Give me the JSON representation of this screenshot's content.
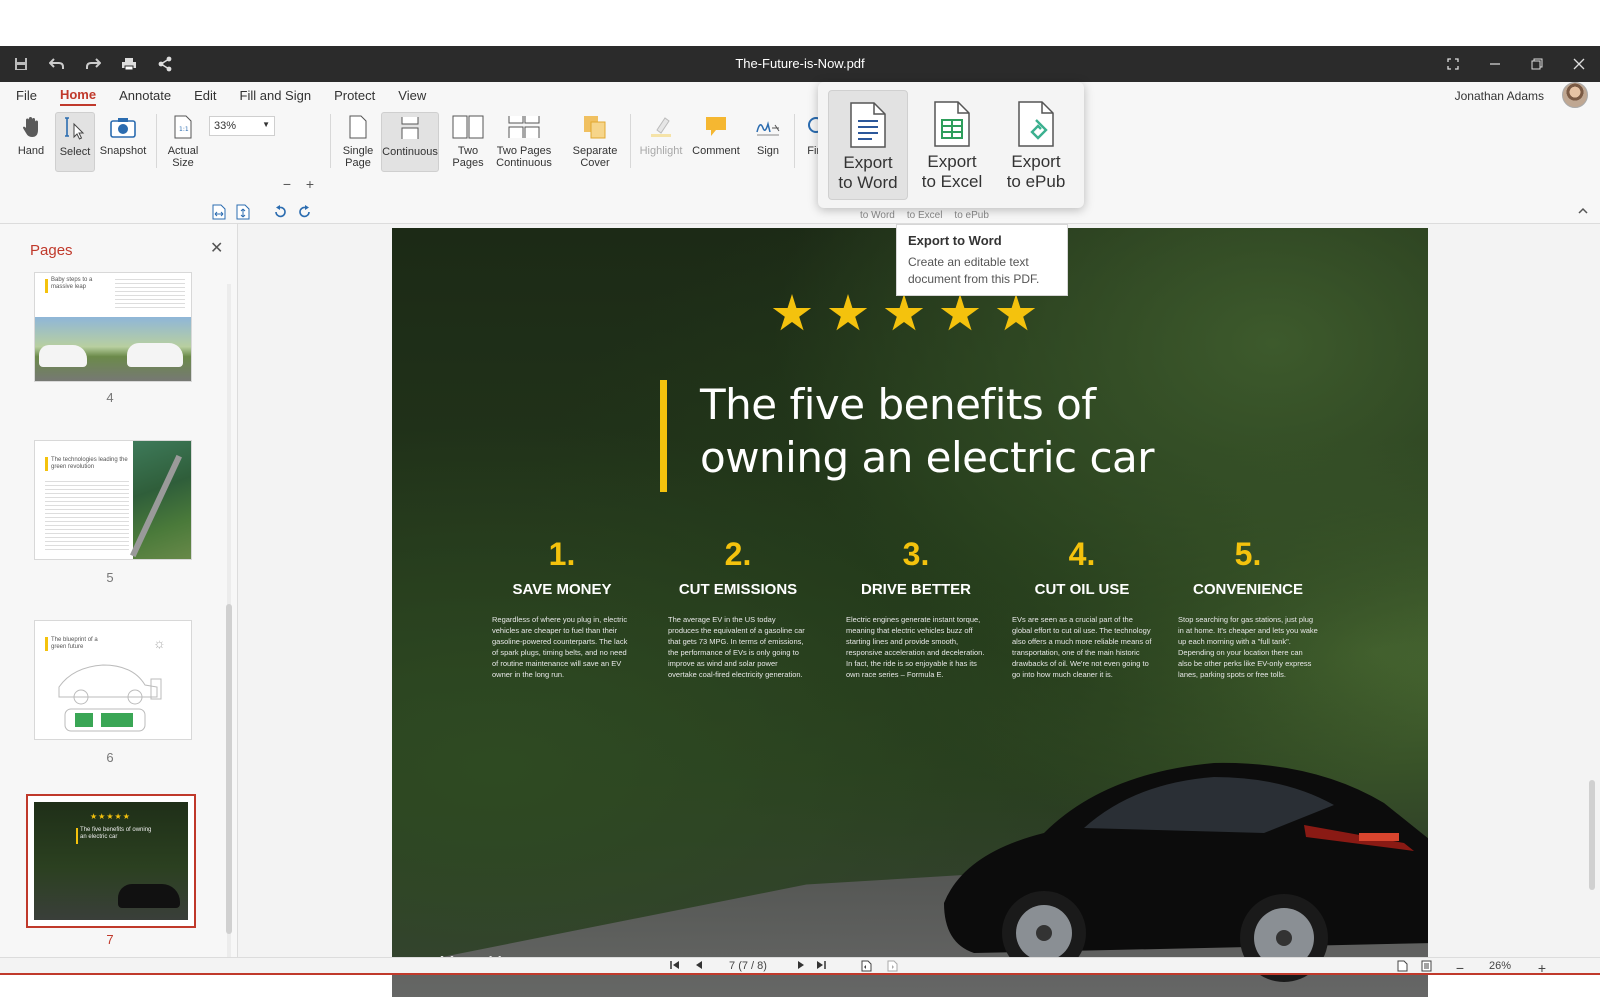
{
  "window": {
    "title": "The-Future-is-Now.pdf"
  },
  "menu": {
    "items": [
      "File",
      "Home",
      "Annotate",
      "Edit",
      "Fill and Sign",
      "Protect",
      "View"
    ],
    "active": "Home"
  },
  "user": {
    "name": "Jonathan Adams"
  },
  "ribbon": {
    "hand": "Hand",
    "select": "Select",
    "snapshot": "Snapshot",
    "actual_size_1": "Actual",
    "actual_size_2": "Size",
    "zoom": "33%",
    "single_page_1": "Single",
    "single_page_2": "Page",
    "continuous": "Continuous",
    "two_pages_1": "Two",
    "two_pages_2": "Pages",
    "two_pages_cont_1": "Two Pages",
    "two_pages_cont_2": "Continuous",
    "separate_cover_1": "Separate",
    "separate_cover_2": "Cover",
    "highlight": "Highlight",
    "comment": "Comment",
    "sign": "Sign",
    "find": "Find",
    "under_word": "to Word",
    "under_excel": "to Excel",
    "under_epub": "to ePub"
  },
  "export_popup": {
    "word_1": "Export",
    "word_2": "to Word",
    "excel_1": "Export",
    "excel_2": "to Excel",
    "epub_1": "Export",
    "epub_2": "to ePub"
  },
  "tooltip": {
    "title": "Export to Word",
    "body": "Create an editable text document from this PDF."
  },
  "pages_panel": {
    "title": "Pages",
    "thumbs": [
      {
        "num": "4",
        "caption": "Baby steps to a massive leap"
      },
      {
        "num": "5",
        "caption": "The technologies leading the green revolution"
      },
      {
        "num": "6",
        "caption": "The blueprint of a green future"
      },
      {
        "num": "7",
        "caption": "The five benefits of owning an electric car"
      }
    ],
    "selected": "7"
  },
  "document": {
    "rating_stars": 5,
    "headline_line1": "The five benefits of",
    "headline_line2": "owning an electric car",
    "benefits": [
      {
        "num": "1.",
        "title": "SAVE MONEY",
        "body": "Regardless of where you plug in, electric vehicles are cheaper to fuel than their gasoline-powered counterparts. The lack of spark plugs, timing belts, and no need of routine maintenance will save an EV owner in the long run."
      },
      {
        "num": "2.",
        "title": "CUT EMISSIONS",
        "body": "The average EV in the US today produces the equivalent of a gasoline car that gets 73 MPG. In terms of emissions, the performance of EVs is only going to improve as wind and solar power overtake coal-fired electricity generation."
      },
      {
        "num": "3.",
        "title": "DRIVE BETTER",
        "body": "Electric engines generate instant torque, meaning that electric vehicles buzz off starting lines and provide smooth, responsive acceleration and deceleration. In fact, the ride is so enjoyable it has its own race series – Formula E."
      },
      {
        "num": "4.",
        "title": "CUT OIL USE",
        "body": "EVs are seen as a crucial part of the global effort to cut oil use. The technology also offers a much more reliable means of transportation, one of the main historic drawbacks of oil. We're not even going to go into how much cleaner it is."
      },
      {
        "num": "5.",
        "title": "CONVENIENCE",
        "body": "Stop searching for gas stations, just plug in at home. It's cheaper and lets you wake up each morning with a \"full tank\". Depending on your location there can also be other perks like EV-only express lanes, parking spots or free tolls."
      }
    ],
    "brand": "mobisystems"
  },
  "statusbar": {
    "page_indicator": "7 (7 / 8)",
    "zoom": "26%"
  },
  "colors": {
    "accent": "#c0392b",
    "star": "#f4c20d",
    "titlebar": "#2b2b2b",
    "excel_green": "#2e9e5b",
    "epub_green": "#3bb08f",
    "word_blue": "#2b579a"
  }
}
